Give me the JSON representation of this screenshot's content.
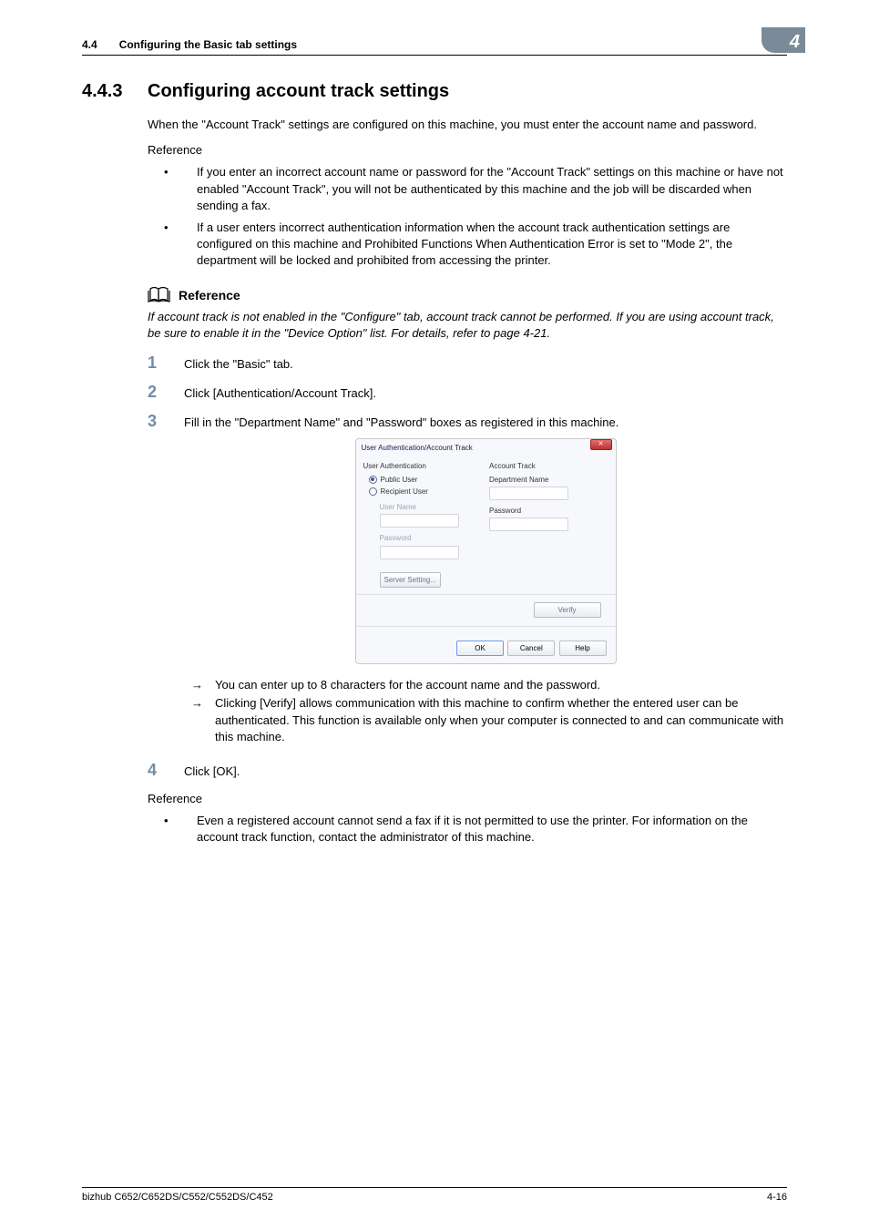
{
  "header": {
    "section_number": "4.4",
    "section_title": "Configuring the Basic tab settings",
    "chapter_number": "4"
  },
  "section": {
    "number": "4.4.3",
    "title": "Configuring account track settings"
  },
  "intro": "When the \"Account Track\" settings are configured on this machine, you must enter the account name and password.",
  "reference_label": "Reference",
  "bullets1": [
    "If you enter an incorrect account name or password for the \"Account Track\" settings on this machine or have not enabled \"Account Track\", you will not be authenticated by this machine and the job will be discarded when sending a fax.",
    "If a user enters incorrect authentication information when the account track authentication settings are configured on this machine and Prohibited Functions When Authentication Error is set to \"Mode 2\", the department will be locked and prohibited from accessing the printer."
  ],
  "ref_block": {
    "head": "Reference",
    "text": "If account track is not enabled in the \"Configure\" tab, account track cannot be performed. If you are using account track, be sure to enable it in the \"Device Option\" list. For details, refer to page 4-21."
  },
  "steps": [
    "Click the \"Basic\" tab.",
    "Click [Authentication/Account Track].",
    "Fill in the \"Department Name\" and \"Password\" boxes as registered in this machine.",
    "Click [OK]."
  ],
  "arrows": [
    "You can enter up to 8 characters for the account name and the password.",
    "Clicking [Verify] allows communication with this machine to confirm whether the entered user can be authenticated. This function is available only when your computer is connected to and can communicate with this machine."
  ],
  "bullets2": [
    "Even a registered account cannot send a fax if it is not permitted to use the printer. For information on the account track function, contact the administrator of this machine."
  ],
  "dialog": {
    "title": "User Authentication/Account Track",
    "left": {
      "group": "User Authentication",
      "public_user": "Public User",
      "recipient_user": "Recipient User",
      "user_name": "User Name",
      "password": "Password",
      "server_setting": "Server Setting..."
    },
    "right": {
      "group": "Account Track",
      "dept_name": "Department Name",
      "password": "Password"
    },
    "verify": "Verify",
    "ok": "OK",
    "cancel": "Cancel",
    "help": "Help"
  },
  "footer": {
    "left": "bizhub C652/C652DS/C552/C552DS/C452",
    "right": "4-16"
  }
}
